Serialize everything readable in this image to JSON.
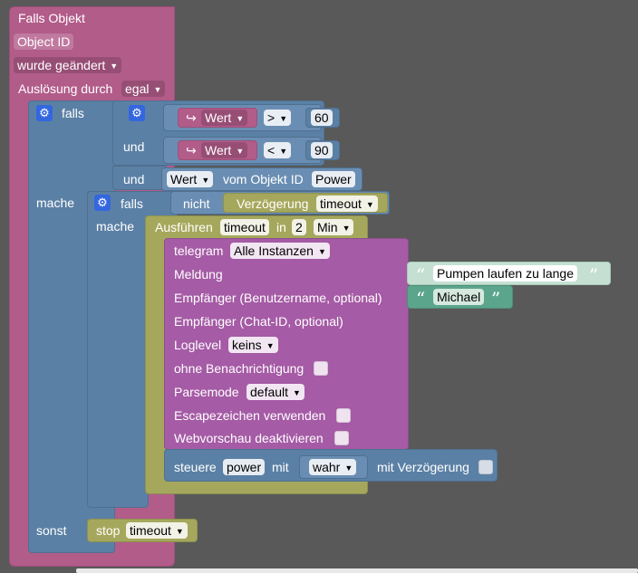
{
  "trigger": {
    "title": "Falls Objekt",
    "object_id_label": "Object ID",
    "changed_dropdown": "wurde geändert",
    "trigger_label": "Auslösung durch",
    "trigger_value": "egal"
  },
  "if_block": {
    "if_label": "falls",
    "do_label": "mache",
    "else_label": "sonst",
    "cond1": {
      "var": "Wert",
      "op": ">",
      "num": "60"
    },
    "and1_label": "und",
    "cond2": {
      "var": "Wert",
      "op": "<",
      "num": "90"
    },
    "and2_label": "und",
    "cond3": {
      "prop": "Wert",
      "from_label": "vom Objekt ID",
      "object": "Power"
    }
  },
  "inner_if": {
    "if_label": "falls",
    "not_label": "nicht",
    "delay_label": "Verzögerung",
    "delay_value": "timeout",
    "do_label": "mache"
  },
  "execute": {
    "label": "Ausführen",
    "timer_name": "timeout",
    "in_label": "in",
    "amount": "2",
    "unit": "Min"
  },
  "telegram": {
    "label": "telegram",
    "instance": "Alle Instanzen",
    "message_label": "Meldung",
    "message_text": "Pumpen laufen zu lange",
    "recipient_user_label": "Empfänger (Benutzername, optional)",
    "recipient_user_value": "Michael",
    "recipient_chat_label": "Empfänger (Chat-ID, optional)",
    "loglevel_label": "Loglevel",
    "loglevel_value": "keins",
    "no_notification_label": "ohne Benachrichtigung",
    "parsemode_label": "Parsemode",
    "parsemode_value": "default",
    "escape_label": "Escapezeichen verwenden",
    "webpreview_label": "Webvorschau deaktivieren"
  },
  "control": {
    "label": "steuere",
    "target": "power",
    "with_label": "mit",
    "value": "wahr",
    "delay_label": "mit Verzögerung"
  },
  "else_stop": {
    "label": "stop",
    "value": "timeout"
  },
  "colors": {
    "trigger": "#b25c8a",
    "logic": "#5b80a5",
    "timer": "#a5a85c",
    "telegram": "#a55ba5",
    "text": "#c5e0d2",
    "workspace": "#595959"
  }
}
